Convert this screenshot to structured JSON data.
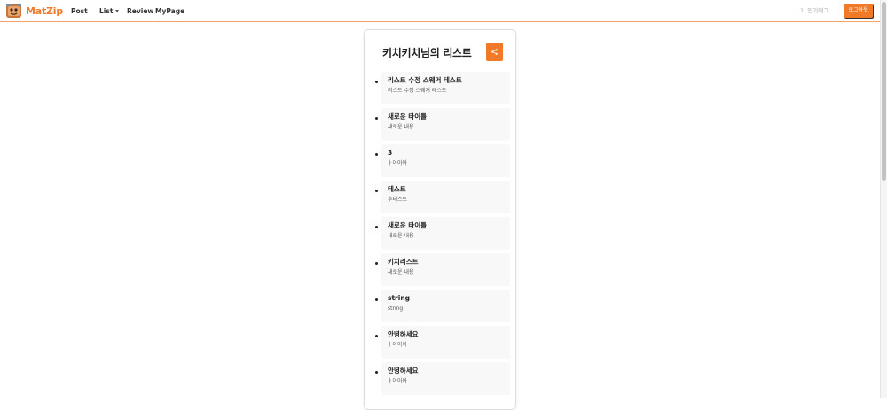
{
  "nav": {
    "logo_text": "MatZip",
    "post": "Post",
    "list": "List",
    "review": "Review",
    "mypage": "MyPage",
    "popular_tag": "1. 인기태그",
    "logout": "로그아웃"
  },
  "card": {
    "title": "키치키치님의 리스트",
    "share_symbol": "share-icon"
  },
  "colors": {
    "accent": "#f07a28",
    "item_bg": "#f8f8f8"
  },
  "items": [
    {
      "title": "리스트 수정 스웨거 테스트",
      "content": "리스트 수정 스웨거 테스트"
    },
    {
      "title": "새로운 타이틀",
      "content": "새로운 내용"
    },
    {
      "title": "3",
      "content": "ㅏ아아아"
    },
    {
      "title": "테스트",
      "content": "후테스트"
    },
    {
      "title": "새로운 타이틀",
      "content": "새로운 내용"
    },
    {
      "title": "키치리스트",
      "content": "새로운 내용"
    },
    {
      "title": "string",
      "content": "string"
    },
    {
      "title": "안녕하세요",
      "content": "ㅏ아아아"
    },
    {
      "title": "안녕하세요",
      "content": "ㅏ아아아"
    }
  ]
}
